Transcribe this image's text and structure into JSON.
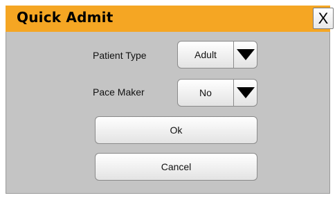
{
  "dialog": {
    "title": "Quick Admit",
    "close_label": "X"
  },
  "fields": {
    "patient_type": {
      "label": "Patient Type",
      "value": "Adult"
    },
    "pace_maker": {
      "label": "Pace Maker",
      "value": "No"
    }
  },
  "buttons": {
    "ok_label": "Ok",
    "cancel_label": "Cancel"
  },
  "icons": {
    "dropdown_arrow": "triangle-down-icon",
    "close": "close-icon"
  },
  "colors": {
    "title_bar": "#f5a623",
    "panel": "#c4c4c4"
  }
}
